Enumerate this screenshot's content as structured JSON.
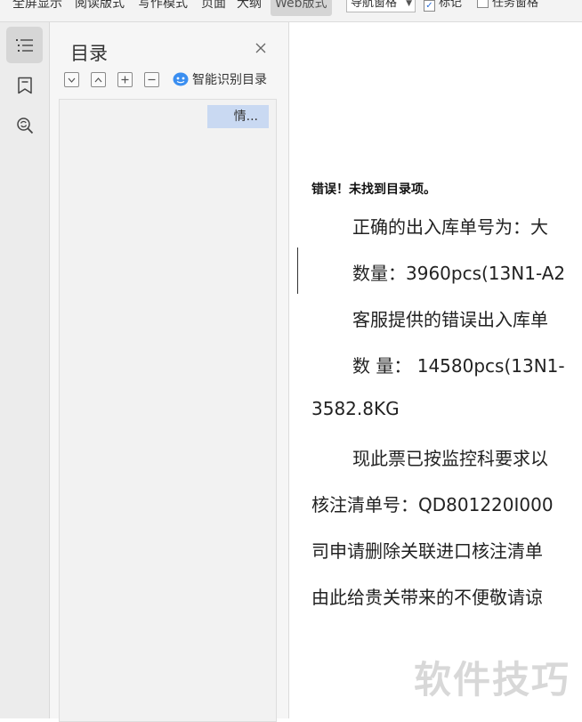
{
  "toolbar": {
    "items": [
      "全屏显示",
      "阅读版式",
      "写作模式",
      "页面",
      "大纲",
      "Web版式"
    ],
    "nav_pane_select": "导航窗格",
    "checkbox_mark": "标记",
    "checkbox_task_pane": "任务窗格"
  },
  "nav_pane": {
    "title": "目录",
    "smart_toc_label": "智能识别目录",
    "toc_item": "情..."
  },
  "document": {
    "error_line": "错误！未找到目录项。",
    "lines": [
      "正确的出入库单号为：大",
      "数量：3960pcs(13N1-A2",
      "客服提供的错误出入库单",
      "数 量： 14580pcs(13N1-",
      "3582.8KG",
      "现此票已按监控科要求以",
      "核注清单号：QD801220I000",
      "司申请删除关联进口核注清单",
      "由此给贵关带来的不便敬请谅"
    ]
  },
  "watermark": "软件技巧"
}
